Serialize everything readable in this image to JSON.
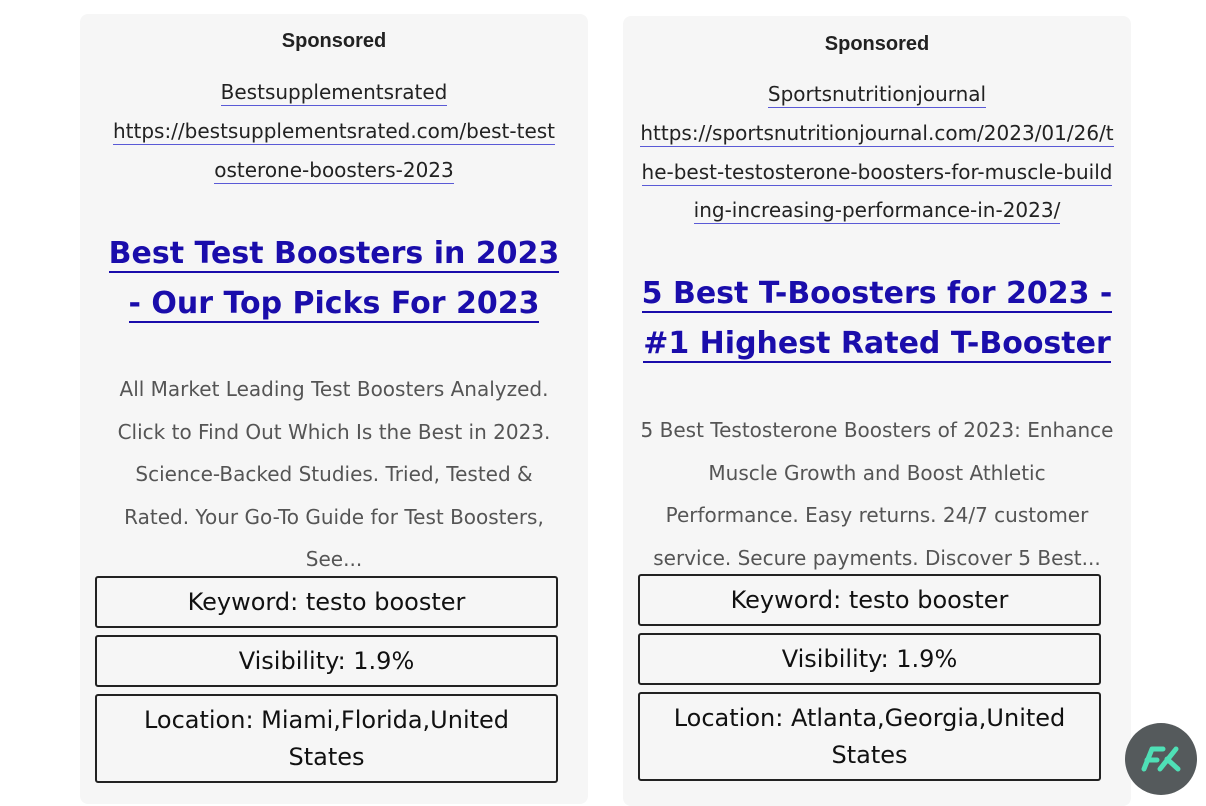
{
  "ads": [
    {
      "sponsored_label": "Sponsored",
      "domain": "Bestsupplementsrated",
      "url": "https://bestsupplementsrated.com/best-testosterone-boosters-2023",
      "headline": "Best Test Boosters in 2023 - Our Top Picks For 2023",
      "description": "All Market Leading Test Boosters Analyzed. Click to Find Out Which Is the Best in 2023. Science-Backed Studies. Tried, Tested & Rated. Your Go-To Guide for Test Boosters, See...",
      "keyword": "Keyword: testo booster",
      "visibility": "Visibility: 1.9%",
      "location": "Location: Miami,Florida,United States"
    },
    {
      "sponsored_label": "Sponsored",
      "domain": "Sportsnutritionjournal",
      "url": "https://sportsnutritionjournal.com/2023/01/26/the-best-testosterone-boosters-for-muscle-building-increasing-performance-in-2023/",
      "headline": "5 Best T-Boosters for 2023 - #1 Highest Rated T-Booster",
      "description": "5 Best Testosterone Boosters of 2023: Enhance Muscle Growth and Boost Athletic Performance. Easy returns. 24/7 customer service. Secure payments. Discover 5 Best...",
      "keyword": "Keyword: testo booster",
      "visibility": "Visibility: 1.9%",
      "location": "Location: Atlanta,Georgia,United States"
    }
  ],
  "badge": {
    "icon": "fk-logo-icon",
    "color": "#4fe0b6",
    "background": "#555a5c"
  }
}
